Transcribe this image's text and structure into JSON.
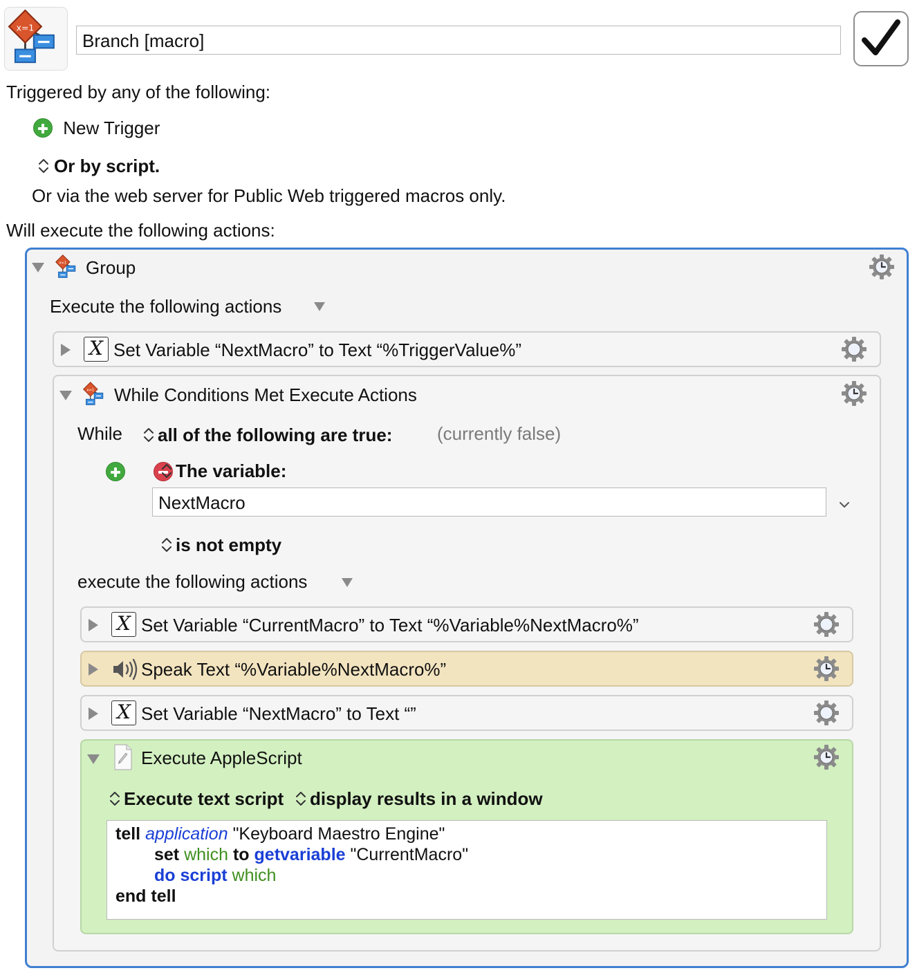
{
  "macro": {
    "name": "Branch [macro]",
    "enabled": true
  },
  "triggers": {
    "heading": "Triggered by any of the following:",
    "new_trigger_label": "New Trigger",
    "or_by_script": "Or by script.",
    "web_server_note": "Or via the web server for Public Web triggered macros only."
  },
  "actions_heading": "Will execute the following actions:",
  "group": {
    "title": "Group",
    "execute_label": "Execute the following actions",
    "set_variable_1": "Set Variable “NextMacro” to Text “%TriggerValue%”",
    "while": {
      "title": "While Conditions Met Execute Actions",
      "while_label": "While",
      "condition_mode": "all of the following are true:",
      "status": "(currently false)",
      "condition_type": "The variable:",
      "variable_name": "NextMacro",
      "operator": "is not empty",
      "execute_label": "execute the following actions",
      "set_variable_2": "Set Variable “CurrentMacro” to Text “%Variable%NextMacro%”",
      "speak_text": "Speak Text “%Variable%NextMacro%”",
      "set_variable_3": "Set Variable “NextMacro” to Text “”",
      "applescript": {
        "title": "Execute AppleScript",
        "mode": "Execute text script",
        "output": "display results in a window",
        "code": {
          "l1_tell": "tell",
          "l1_application": "application",
          "l1_string": "\"Keyboard Maestro Engine\"",
          "l2_set": "set",
          "l2_which": "which",
          "l2_to": "to",
          "l2_getvariable": "getvariable",
          "l2_string": "\"CurrentMacro\"",
          "l3_do_script": "do script",
          "l3_which": "which",
          "l4_end_tell": "end tell"
        }
      }
    }
  },
  "icons": [
    "macro-group-icon",
    "checkmark-icon",
    "add-icon",
    "remove-icon",
    "up-down-arrows-icon",
    "variable-x-icon",
    "speaker-icon",
    "applescript-icon",
    "gear-clock-icon",
    "disclosure-triangle-icon",
    "chevron-down-icon"
  ],
  "colors": {
    "group_border": "#3f7fd1",
    "speak_background": "#f3e4c0",
    "applescript_background": "#d3f0c1",
    "keyword_blue": "#1a3fd6",
    "variable_green": "#3f8f1f"
  }
}
